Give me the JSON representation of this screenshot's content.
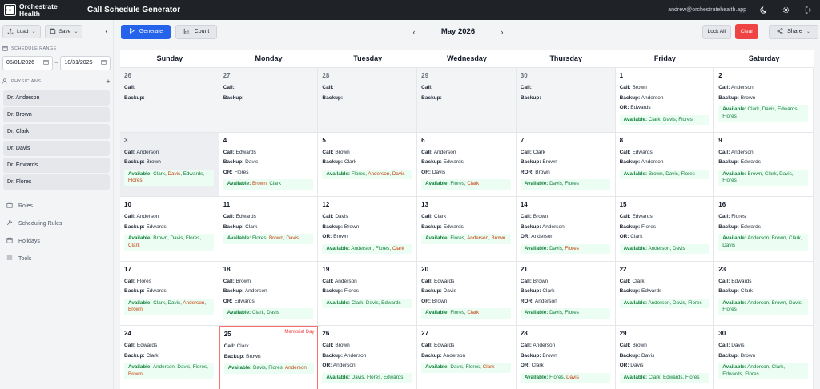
{
  "app": {
    "logo_text": "Orchestrate Health",
    "title": "Call Schedule Generator",
    "user_email": "andrew@orchestratehealth.app"
  },
  "toolbar": {
    "load_label": "Load",
    "save_label": "Save",
    "generate_label": "Generate",
    "count_label": "Count",
    "month_label": "May 2026",
    "lock_all_label": "Lock All",
    "clear_label": "Clear",
    "share_label": "Share"
  },
  "sidebar": {
    "schedule_range_label": "SCHEDULE RANGE",
    "start_date": "05/01/2026",
    "end_date": "10/31/2026",
    "date_separator": "–",
    "physicians_label": "PHYSICIANS",
    "physicians": [
      "Dr. Anderson",
      "Dr. Brown",
      "Dr. Clark",
      "Dr. Davis",
      "Dr. Edwards",
      "Dr. Flores"
    ],
    "nav": [
      {
        "label": "Roles",
        "icon": "briefcase-icon"
      },
      {
        "label": "Scheduling Rules",
        "icon": "wrench-icon"
      },
      {
        "label": "Holidays",
        "icon": "calendar-icon"
      },
      {
        "label": "Tools",
        "icon": "list-icon"
      }
    ]
  },
  "calendar": {
    "weekdays": [
      "Sunday",
      "Monday",
      "Tuesday",
      "Wednesday",
      "Thursday",
      "Friday",
      "Saturday"
    ],
    "labels": {
      "call": "Call:",
      "backup": "Backup:",
      "or": "OR:",
      "ror": "ROR:",
      "available": "Available:"
    },
    "days": [
      {
        "num": "26",
        "other": true,
        "call": "",
        "backup": ""
      },
      {
        "num": "27",
        "other": true,
        "call": "",
        "backup": ""
      },
      {
        "num": "28",
        "other": true,
        "call": "",
        "backup": ""
      },
      {
        "num": "29",
        "other": true,
        "call": "",
        "backup": ""
      },
      {
        "num": "30",
        "other": true,
        "call": "",
        "backup": ""
      },
      {
        "num": "1",
        "call": "Brown",
        "backup": "Anderson",
        "or": "Edwards",
        "available": [
          {
            "n": "Clark"
          },
          {
            "n": "Davis"
          },
          {
            "n": "Flores"
          }
        ]
      },
      {
        "num": "2",
        "call": "Anderson",
        "backup": "Brown",
        "available": [
          {
            "n": "Clark"
          },
          {
            "n": "Davis"
          },
          {
            "n": "Edwards"
          },
          {
            "n": "Flores"
          }
        ]
      },
      {
        "num": "3",
        "selected": true,
        "call": "Anderson",
        "backup": "Brown",
        "available": [
          {
            "n": "Clark"
          },
          {
            "n": "Davis",
            "w": true
          },
          {
            "n": "Edwards"
          },
          {
            "n": "Flores",
            "w": true
          }
        ]
      },
      {
        "num": "4",
        "call": "Edwards",
        "backup": "Davis",
        "or": "Flores",
        "available": [
          {
            "n": "Brown",
            "w": true
          },
          {
            "n": "Clark"
          }
        ]
      },
      {
        "num": "5",
        "call": "Brown",
        "backup": "Clark",
        "available": [
          {
            "n": "Flores"
          },
          {
            "n": "Anderson",
            "w": true
          },
          {
            "n": "Davis",
            "w": true
          }
        ]
      },
      {
        "num": "6",
        "call": "Anderson",
        "backup": "Edwards",
        "or": "Davis",
        "available": [
          {
            "n": "Flores"
          },
          {
            "n": "Clark",
            "w": true
          }
        ]
      },
      {
        "num": "7",
        "call": "Clark",
        "backup": "Brown",
        "ror": "Brown",
        "available": [
          {
            "n": "Davis"
          },
          {
            "n": "Flores"
          }
        ]
      },
      {
        "num": "8",
        "call": "Edwards",
        "backup": "Anderson",
        "available": [
          {
            "n": "Brown"
          },
          {
            "n": "Davis"
          },
          {
            "n": "Flores"
          }
        ]
      },
      {
        "num": "9",
        "call": "Anderson",
        "backup": "Edwards",
        "available": [
          {
            "n": "Brown"
          },
          {
            "n": "Clark"
          },
          {
            "n": "Davis"
          },
          {
            "n": "Flores"
          }
        ]
      },
      {
        "num": "10",
        "call": "Anderson",
        "backup": "Edwards",
        "available": [
          {
            "n": "Brown"
          },
          {
            "n": "Davis"
          },
          {
            "n": "Flores"
          },
          {
            "n": "Clark",
            "w": true
          }
        ]
      },
      {
        "num": "11",
        "call": "Edwards",
        "backup": "Clark",
        "available": [
          {
            "n": "Flores"
          },
          {
            "n": "Brown",
            "w": true
          },
          {
            "n": "Davis",
            "w": true
          }
        ]
      },
      {
        "num": "12",
        "call": "Davis",
        "backup": "Brown",
        "or": "Brown",
        "available": [
          {
            "n": "Anderson"
          },
          {
            "n": "Flores"
          },
          {
            "n": "Clark",
            "w": true
          }
        ]
      },
      {
        "num": "13",
        "call": "Clark",
        "backup": "Edwards",
        "available": [
          {
            "n": "Flores"
          },
          {
            "n": "Anderson",
            "w": true
          },
          {
            "n": "Brown",
            "w": true
          }
        ]
      },
      {
        "num": "14",
        "call": "Brown",
        "backup": "Anderson",
        "or": "Anderson",
        "available": [
          {
            "n": "Davis"
          },
          {
            "n": "Flores",
            "w": true
          }
        ]
      },
      {
        "num": "15",
        "call": "Edwards",
        "backup": "Flores",
        "or": "Clark",
        "available": [
          {
            "n": "Anderson"
          },
          {
            "n": "Davis"
          }
        ]
      },
      {
        "num": "16",
        "call": "Flores",
        "backup": "Edwards",
        "available": [
          {
            "n": "Anderson"
          },
          {
            "n": "Brown"
          },
          {
            "n": "Clark"
          },
          {
            "n": "Davis"
          }
        ]
      },
      {
        "num": "17",
        "call": "Flores",
        "backup": "Edwards",
        "available": [
          {
            "n": "Clark"
          },
          {
            "n": "Davis"
          },
          {
            "n": "Anderson",
            "w": true
          },
          {
            "n": "Brown",
            "w": true
          }
        ]
      },
      {
        "num": "18",
        "call": "Brown",
        "backup": "Anderson",
        "or": "Edwards",
        "available": [
          {
            "n": "Clark"
          },
          {
            "n": "Davis"
          }
        ]
      },
      {
        "num": "19",
        "call": "Anderson",
        "backup": "Flores",
        "available": [
          {
            "n": "Clark"
          },
          {
            "n": "Davis"
          },
          {
            "n": "Edwards"
          }
        ]
      },
      {
        "num": "20",
        "call": "Edwards",
        "backup": "Davis",
        "or": "Brown",
        "available": [
          {
            "n": "Flores"
          },
          {
            "n": "Clark",
            "w": true
          }
        ]
      },
      {
        "num": "21",
        "call": "Brown",
        "backup": "Clark",
        "ror": "Anderson",
        "available": [
          {
            "n": "Davis"
          },
          {
            "n": "Flores"
          }
        ]
      },
      {
        "num": "22",
        "call": "Clark",
        "backup": "Edwards",
        "available": [
          {
            "n": "Anderson"
          },
          {
            "n": "Davis"
          },
          {
            "n": "Flores"
          }
        ]
      },
      {
        "num": "23",
        "call": "Edwards",
        "backup": "Clark",
        "available": [
          {
            "n": "Anderson"
          },
          {
            "n": "Brown"
          },
          {
            "n": "Davis"
          },
          {
            "n": "Flores"
          }
        ]
      },
      {
        "num": "24",
        "call": "Edwards",
        "backup": "Clark",
        "available": [
          {
            "n": "Anderson"
          },
          {
            "n": "Davis"
          },
          {
            "n": "Flores"
          },
          {
            "n": "Brown",
            "w": true
          }
        ]
      },
      {
        "num": "25",
        "holiday": "Memorial Day",
        "call": "Clark",
        "backup": "Brown",
        "available": [
          {
            "n": "Davis"
          },
          {
            "n": "Flores"
          },
          {
            "n": "Anderson",
            "w": true
          }
        ]
      },
      {
        "num": "26",
        "call": "Brown",
        "backup": "Anderson",
        "or": "Anderson",
        "available": [
          {
            "n": "Davis"
          },
          {
            "n": "Flores"
          },
          {
            "n": "Edwards"
          }
        ]
      },
      {
        "num": "27",
        "call": "Edwards",
        "backup": "Anderson",
        "available": [
          {
            "n": "Davis"
          },
          {
            "n": "Flores"
          },
          {
            "n": "Clark",
            "w": true
          }
        ]
      },
      {
        "num": "28",
        "call": "Anderson",
        "backup": "Brown",
        "or": "Clark",
        "available": [
          {
            "n": "Flores"
          },
          {
            "n": "Davis",
            "w": true
          }
        ]
      },
      {
        "num": "29",
        "call": "Brown",
        "backup": "Davis",
        "or": "Davis",
        "available": [
          {
            "n": "Clark"
          },
          {
            "n": "Edwards"
          },
          {
            "n": "Flores"
          }
        ]
      },
      {
        "num": "30",
        "call": "Davis",
        "backup": "Brown",
        "available": [
          {
            "n": "Anderson"
          },
          {
            "n": "Clark"
          },
          {
            "n": "Edwards"
          },
          {
            "n": "Flores"
          }
        ]
      }
    ]
  }
}
